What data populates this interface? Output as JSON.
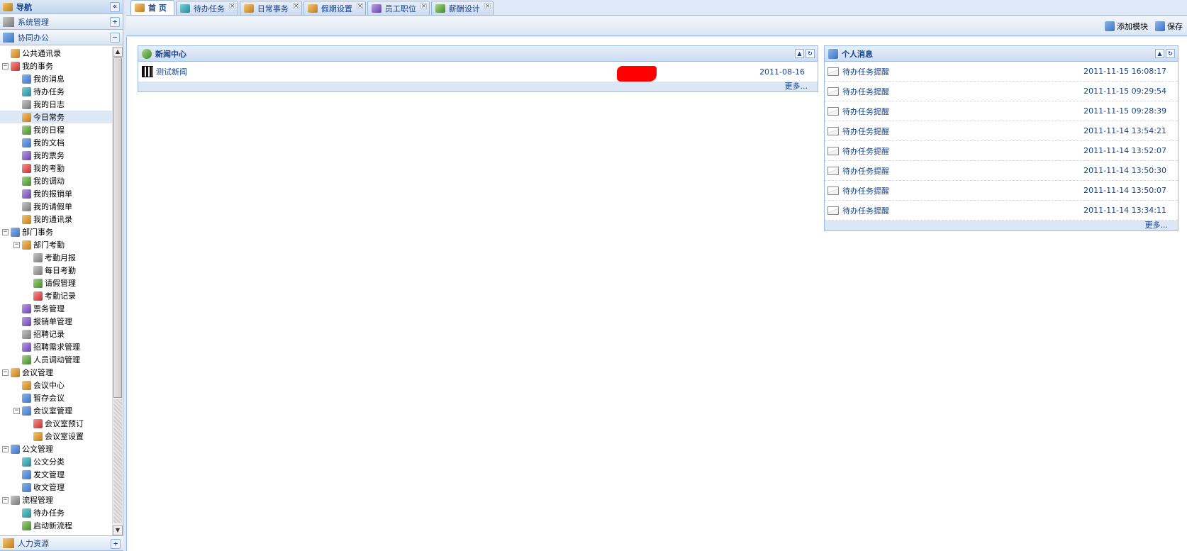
{
  "nav": {
    "title": "导航",
    "collapse_glyph": "«",
    "sections": [
      {
        "label": "系统管理",
        "toggle": "+"
      },
      {
        "label": "协同办公",
        "toggle": "−"
      }
    ],
    "bottom_section": {
      "label": "人力资源",
      "toggle": "+"
    },
    "tree": [
      {
        "label": "公共通讯录",
        "depth": 0,
        "toggle": "",
        "icon": "address-book-icon",
        "ic": "i1"
      },
      {
        "label": "我的事务",
        "depth": 0,
        "toggle": "−",
        "icon": "calendar-icon",
        "ic": "i5"
      },
      {
        "label": "我的消息",
        "depth": 1,
        "toggle": "",
        "icon": "folder-icon",
        "ic": "i0"
      },
      {
        "label": "待办任务",
        "depth": 1,
        "toggle": "",
        "icon": "task-icon",
        "ic": "i6"
      },
      {
        "label": "我的日志",
        "depth": 1,
        "toggle": "",
        "icon": "log-icon",
        "ic": "i3"
      },
      {
        "label": "今日常务",
        "depth": 1,
        "toggle": "",
        "icon": "today-icon",
        "ic": "i1",
        "selected": true
      },
      {
        "label": "我的日程",
        "depth": 1,
        "toggle": "",
        "icon": "schedule-icon",
        "ic": "i2"
      },
      {
        "label": "我的文档",
        "depth": 1,
        "toggle": "",
        "icon": "document-icon",
        "ic": "i0"
      },
      {
        "label": "我的票务",
        "depth": 1,
        "toggle": "",
        "icon": "ticket-icon",
        "ic": "i4"
      },
      {
        "label": "我的考勤",
        "depth": 1,
        "toggle": "",
        "icon": "attendance-icon",
        "ic": "i5"
      },
      {
        "label": "我的调动",
        "depth": 1,
        "toggle": "",
        "icon": "transfer-icon",
        "ic": "i2"
      },
      {
        "label": "我的报销单",
        "depth": 1,
        "toggle": "",
        "icon": "reimburse-icon",
        "ic": "i4"
      },
      {
        "label": "我的请假单",
        "depth": 1,
        "toggle": "",
        "icon": "leave-icon",
        "ic": "i3"
      },
      {
        "label": "我的通讯录",
        "depth": 1,
        "toggle": "",
        "icon": "contacts-icon",
        "ic": "i1"
      },
      {
        "label": "部门事务",
        "depth": 0,
        "toggle": "−",
        "icon": "department-icon",
        "ic": "i0"
      },
      {
        "label": "部门考勤",
        "depth": 1,
        "toggle": "−",
        "icon": "user-icon",
        "ic": "i1"
      },
      {
        "label": "考勤月报",
        "depth": 2,
        "toggle": "",
        "icon": "report-icon",
        "ic": "i3"
      },
      {
        "label": "每日考勤",
        "depth": 2,
        "toggle": "",
        "icon": "clock-icon",
        "ic": "i3"
      },
      {
        "label": "请假管理",
        "depth": 2,
        "toggle": "",
        "icon": "tag-icon",
        "ic": "i2"
      },
      {
        "label": "考勤记录",
        "depth": 2,
        "toggle": "",
        "icon": "table-icon",
        "ic": "i5"
      },
      {
        "label": "票务管理",
        "depth": 1,
        "toggle": "",
        "icon": "ticket-icon",
        "ic": "i4"
      },
      {
        "label": "报销单管理",
        "depth": 1,
        "toggle": "",
        "icon": "reimburse-icon",
        "ic": "i4"
      },
      {
        "label": "招聘记录",
        "depth": 1,
        "toggle": "",
        "icon": "record-icon",
        "ic": "i3"
      },
      {
        "label": "招聘需求管理",
        "depth": 1,
        "toggle": "",
        "icon": "id-card-icon",
        "ic": "i4"
      },
      {
        "label": "人员调动管理",
        "depth": 1,
        "toggle": "",
        "icon": "transfer-icon",
        "ic": "i2"
      },
      {
        "label": "会议管理",
        "depth": 0,
        "toggle": "−",
        "icon": "meeting-icon",
        "ic": "i1"
      },
      {
        "label": "会议中心",
        "depth": 1,
        "toggle": "",
        "icon": "meeting-icon",
        "ic": "i1"
      },
      {
        "label": "暂存会议",
        "depth": 1,
        "toggle": "",
        "icon": "draft-icon",
        "ic": "i0"
      },
      {
        "label": "会议室管理",
        "depth": 1,
        "toggle": "−",
        "icon": "room-icon",
        "ic": "i0"
      },
      {
        "label": "会议室预订",
        "depth": 2,
        "toggle": "",
        "icon": "booking-icon",
        "ic": "i5"
      },
      {
        "label": "会议室设置",
        "depth": 2,
        "toggle": "",
        "icon": "settings-icon",
        "ic": "i1"
      },
      {
        "label": "公文管理",
        "depth": 0,
        "toggle": "−",
        "icon": "briefcase-icon",
        "ic": "i0"
      },
      {
        "label": "公文分类",
        "depth": 1,
        "toggle": "",
        "icon": "category-icon",
        "ic": "i6"
      },
      {
        "label": "发文管理",
        "depth": 1,
        "toggle": "",
        "icon": "send-doc-icon",
        "ic": "i0"
      },
      {
        "label": "收文管理",
        "depth": 1,
        "toggle": "",
        "icon": "receive-doc-icon",
        "ic": "i0"
      },
      {
        "label": "流程管理",
        "depth": 0,
        "toggle": "−",
        "icon": "flow-icon",
        "ic": "i3"
      },
      {
        "label": "待办任务",
        "depth": 1,
        "toggle": "",
        "icon": "task-icon",
        "ic": "i6"
      },
      {
        "label": "启动新流程",
        "depth": 1,
        "toggle": "",
        "icon": "new-flow-icon",
        "ic": "i2"
      }
    ]
  },
  "tabs": [
    {
      "label": "首 页",
      "icon": "home-icon",
      "ic": "i1",
      "active": true
    },
    {
      "label": "待办任务",
      "icon": "task-icon",
      "ic": "i6"
    },
    {
      "label": "日常事务",
      "icon": "today-icon",
      "ic": "i1"
    },
    {
      "label": "假期设置",
      "icon": "clipboard-icon",
      "ic": "i1"
    },
    {
      "label": "员工职位",
      "icon": "user-icon",
      "ic": "i4"
    },
    {
      "label": "薪酬设计",
      "icon": "salary-icon",
      "ic": "i2"
    }
  ],
  "tab_close_glyph": "×",
  "toolbar": {
    "add_module_label": "添加模块",
    "save_label": "保存"
  },
  "news": {
    "title": "新闻中心",
    "items": [
      {
        "title": "测试新闻",
        "date": "2011-08-16"
      }
    ],
    "more": "更多..."
  },
  "messages": {
    "title": "个人消息",
    "items": [
      {
        "title": "待办任务提醒",
        "date": "2011-11-15 16:08:17"
      },
      {
        "title": "待办任务提醒",
        "date": "2011-11-15 09:29:54"
      },
      {
        "title": "待办任务提醒",
        "date": "2011-11-15 09:28:39"
      },
      {
        "title": "待办任务提醒",
        "date": "2011-11-14 13:54:21"
      },
      {
        "title": "待办任务提醒",
        "date": "2011-11-14 13:52:07"
      },
      {
        "title": "待办任务提醒",
        "date": "2011-11-14 13:50:30"
      },
      {
        "title": "待办任务提醒",
        "date": "2011-11-14 13:50:07"
      },
      {
        "title": "待办任务提醒",
        "date": "2011-11-14 13:34:11"
      }
    ],
    "more": "更多..."
  },
  "portlet_tools": {
    "collapse": "▲",
    "refresh": "↻"
  },
  "scroll_glyphs": {
    "up": "▲",
    "down": "▼"
  }
}
